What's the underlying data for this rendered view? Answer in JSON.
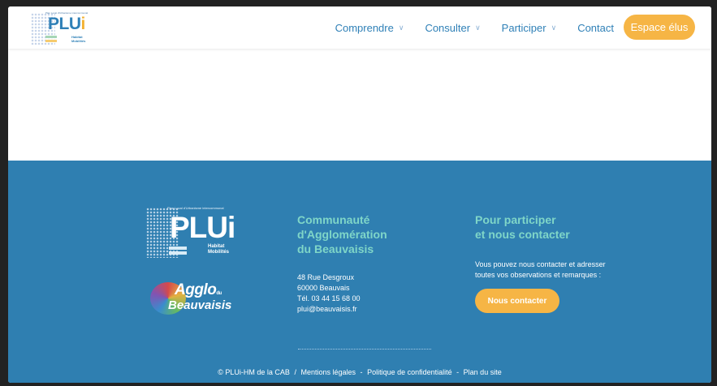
{
  "header": {
    "logo": {
      "tagline": "Plan Local d'Urbanisme intercommunal",
      "wordmark_main": "PLU",
      "wordmark_i": "i",
      "sub_line1": "Habitat",
      "sub_line2": "Mobilités"
    },
    "nav": [
      {
        "label": "Comprendre",
        "has_dropdown": true
      },
      {
        "label": "Consulter",
        "has_dropdown": true
      },
      {
        "label": "Participer",
        "has_dropdown": true
      },
      {
        "label": "Contact",
        "has_dropdown": false
      }
    ],
    "cta_label": "Espace élus"
  },
  "footer": {
    "plui_logo": {
      "tagline": "Plan Local d'Urbanisme intercommunal",
      "wordmark": "PLUi",
      "sub_line1": "Habitat",
      "sub_line2": "Mobilités"
    },
    "agglo_logo": {
      "line1": "Agglo",
      "line1_suffix": "du",
      "line2": "Beauvaisis"
    },
    "community": {
      "title_lines": [
        "Communauté",
        "d'Agglomération",
        "du Beauvaisis"
      ],
      "address_lines": [
        "48 Rue Desgroux",
        "60000 Beauvais",
        "Tél. 03 44 15 68 00",
        "plui@beauvaisis.fr"
      ]
    },
    "participate": {
      "title_lines": [
        "Pour participer",
        "et nous contacter"
      ],
      "text": "Vous pouvez nous contacter et adresser toutes vos observations et remarques :",
      "button_label": "Nous contacter"
    },
    "legal": {
      "copyright": "© PLUi-HM de la CAB",
      "sep": "/",
      "links": [
        "Mentions légales",
        "Politique de confidentialité",
        "Plan du site"
      ],
      "link_sep": "-"
    }
  },
  "colors": {
    "brand_blue": "#2f7fb1",
    "accent_orange": "#f6b545",
    "teal_title": "#7fd6c8"
  }
}
